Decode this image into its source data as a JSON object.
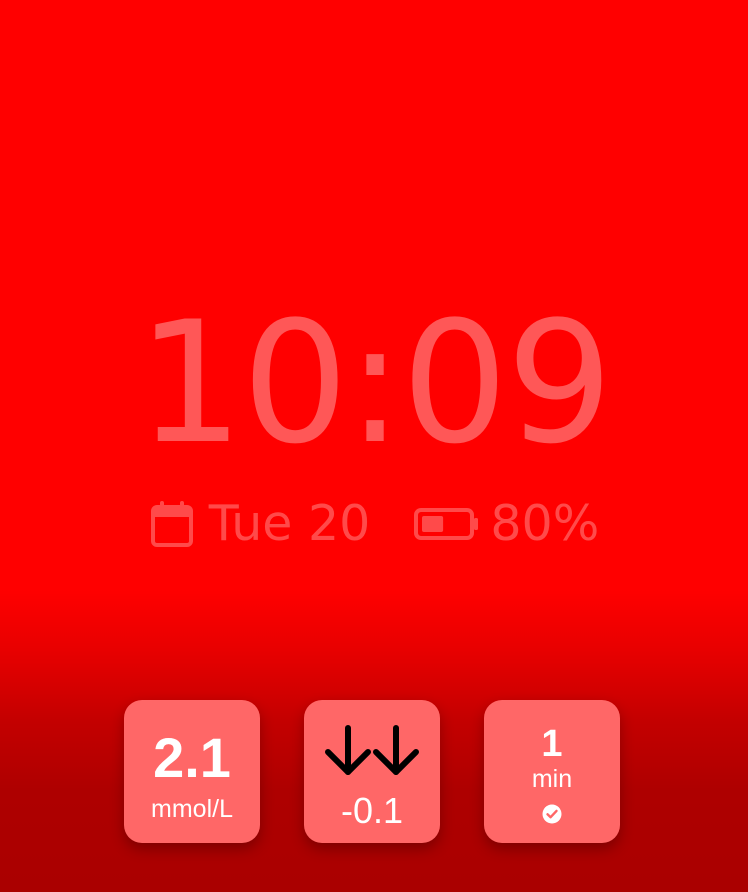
{
  "clock": {
    "time": "10:09"
  },
  "info": {
    "date": "Tue 20",
    "battery": "80%",
    "battery_level": 0.8,
    "calendar_icon": "calendar-icon",
    "battery_icon": "battery-icon"
  },
  "complications": {
    "glucose": {
      "value": "2.1",
      "unit": "mmol/L"
    },
    "trend": {
      "arrows_icon": "double-down-arrow-icon",
      "delta": "-0.1"
    },
    "reading_age": {
      "value": "1",
      "unit": "min",
      "status_icon": "checkmark-icon"
    }
  },
  "colors": {
    "background_top": "#ff0000",
    "background_bottom": "#aa0000",
    "clock_text": "#ff5757",
    "info_text": "#ff4a4a",
    "complication_bg": "#ff6767",
    "complication_text": "#ffffff"
  }
}
